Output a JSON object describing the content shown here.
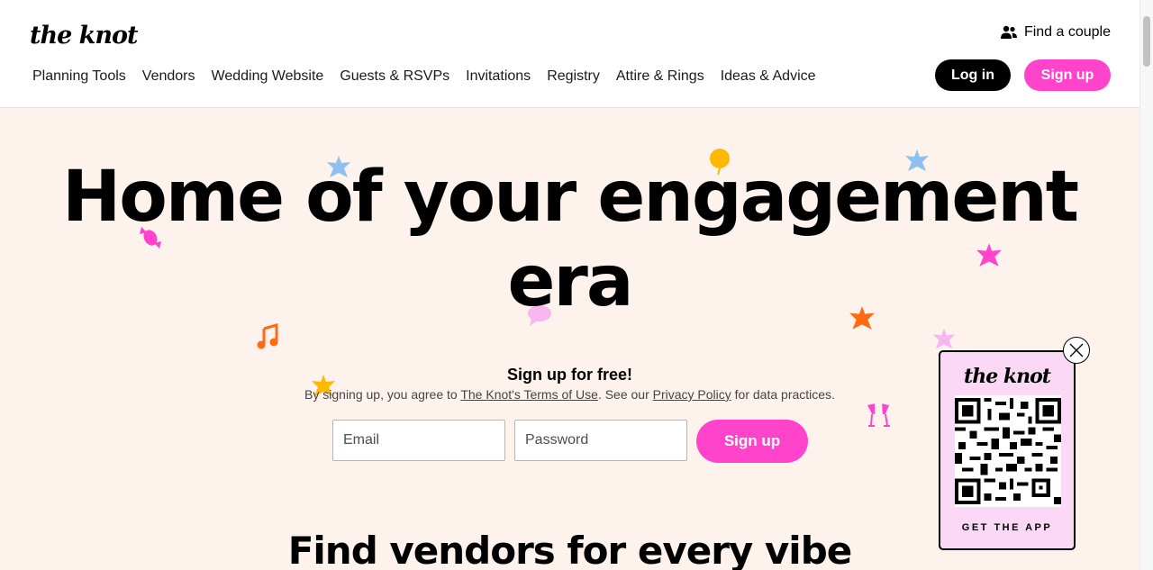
{
  "header": {
    "logo": "the knot",
    "find_couple": "Find a couple",
    "nav": [
      {
        "label": "Planning Tools"
      },
      {
        "label": "Vendors"
      },
      {
        "label": "Wedding Website"
      },
      {
        "label": "Guests & RSVPs"
      },
      {
        "label": "Invitations"
      },
      {
        "label": "Registry"
      },
      {
        "label": "Attire & Rings"
      },
      {
        "label": "Ideas & Advice"
      }
    ],
    "login_label": "Log in",
    "signup_label": "Sign up"
  },
  "hero": {
    "title": "Home of your engagement era",
    "signup_title": "Sign up for free!",
    "terms_prefix": "By signing up, you agree to ",
    "terms_link": "The Knot's Terms of Use",
    "terms_middle": ". See our ",
    "privacy_link": "Privacy Policy",
    "terms_suffix": " for data practices.",
    "email_placeholder": "Email",
    "password_placeholder": "Password",
    "submit_label": "Sign up"
  },
  "vendors_title": "Find vendors for every vibe",
  "app_promo": {
    "logo": "the knot",
    "cta": "GET THE APP"
  },
  "colors": {
    "accent_pink": "#ff44cb",
    "hero_bg": "#fdf3ec",
    "promo_bg": "#fbd8f5"
  },
  "icons": [
    "people-icon",
    "close-icon",
    "qr-code",
    "star-icon",
    "music-note-icon",
    "balloon-icon",
    "speech-bubble-icon",
    "champagne-icon",
    "candy-icon"
  ]
}
